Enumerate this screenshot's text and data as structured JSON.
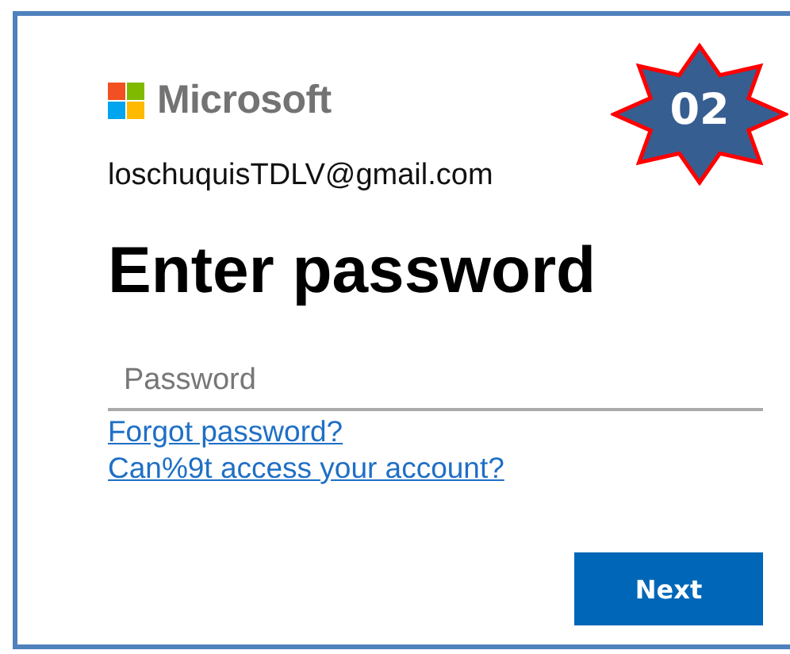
{
  "brand": {
    "name": "Microsoft"
  },
  "account": "loschuquisTDLV@gmail.com",
  "heading": "Enter password",
  "password_field": {
    "placeholder": "Password"
  },
  "links": [
    "Forgot password?",
    "Can%9t access your account?"
  ],
  "buttons": [
    {
      "label": "Next"
    }
  ],
  "badge": {
    "label": "02"
  }
}
